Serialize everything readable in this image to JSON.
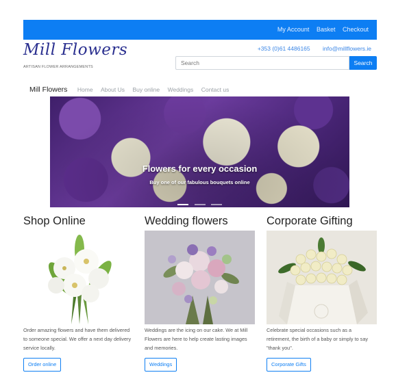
{
  "header": {
    "links": [
      "My Account",
      "Basket",
      "Checkout"
    ],
    "logo": "Mill Flowers",
    "tagline": "ARTISAN FLOWER ARRANGEMENTS",
    "phone": "+353 (0)61 4486165",
    "email": "info@millflowers.ie",
    "accent_color": "#0d7ef3"
  },
  "search": {
    "placeholder": "Search",
    "button_label": "Search"
  },
  "nav": {
    "brand": "Mill Flowers",
    "items": [
      "Home",
      "About Us",
      "Buy online",
      "Weddings",
      "Contact us"
    ]
  },
  "hero": {
    "title": "Flowers for every occasion",
    "subtitle": "Buy one of our fabulous bouquets online",
    "slide_count": 3,
    "active_slide": 0
  },
  "sections": [
    {
      "heading": "Shop Online",
      "image": "white lilies bouquet",
      "text": "Order amazing flowers and have them delivered to someone special. We offer a next day delivery service locally.",
      "button": "Order online"
    },
    {
      "heading": "Wedding flowers",
      "image": "pastel wedding bouquet",
      "text": "Weddings are the icing on our cake. We at Mill Flowers are here to help create lasting images and memories.",
      "button": "Weddings"
    },
    {
      "heading": "Corporate Gifting",
      "image": "white roses in box",
      "text": "Celebrate special occasions such as a retirement, the birth of a baby or simply to say \"thank you\".",
      "button": "Corporate Gifts"
    }
  ]
}
